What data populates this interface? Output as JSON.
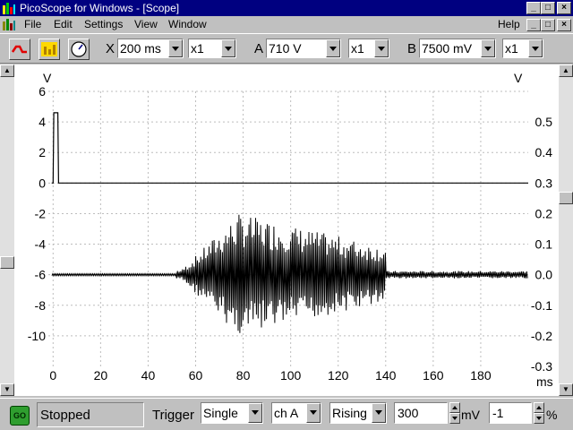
{
  "window": {
    "title": "PicoScope for Windows - [Scope]"
  },
  "menu": {
    "items": [
      "File",
      "Edit",
      "Settings",
      "View",
      "Window"
    ],
    "help": "Help"
  },
  "toolbar": {
    "buttons": [
      {
        "icon": "scope-view-icon"
      },
      {
        "icon": "spectrum-view-icon"
      },
      {
        "icon": "meter-view-icon"
      }
    ],
    "x_label": "X",
    "x_timebase": "200 ms",
    "x_zoom": "x1",
    "a_label": "A",
    "a_range": "710 V",
    "a_zoom": "x1",
    "b_label": "B",
    "b_range": "7500 mV",
    "b_zoom": "x1"
  },
  "chart_data": {
    "type": "line",
    "x_ticks": [
      "0",
      "20",
      "40",
      "60",
      "80",
      "100",
      "120",
      "140",
      "160",
      "180"
    ],
    "x_unit": "ms",
    "xlim": [
      -2,
      200
    ],
    "left_axis": {
      "unit": "V",
      "ticks": [
        "6",
        "4",
        "2",
        "0",
        "-2",
        "-4",
        "-6",
        "-8",
        "-10"
      ],
      "ylim": [
        -12,
        6
      ]
    },
    "right_axis": {
      "unit": "V",
      "ticks": [
        "0.5",
        "0.4",
        "0.3",
        "0.2",
        "0.1",
        "0.0",
        "-0.1",
        "-0.2",
        "-0.3"
      ],
      "ylim": [
        -0.3,
        0.6
      ]
    },
    "grid": true,
    "series": [
      {
        "channel": "A",
        "axis": "left",
        "color": "#000000",
        "points": [
          [
            -0.6,
            0
          ],
          [
            0,
            0
          ],
          [
            0.3,
            4.6
          ],
          [
            2,
            4.6
          ],
          [
            2.3,
            0
          ],
          [
            3,
            0
          ],
          [
            200,
            0
          ]
        ]
      },
      {
        "channel": "B",
        "axis": "right",
        "color": "#000000",
        "baseline": 0.0,
        "burst": {
          "start_ms": 52,
          "end_ms": 140,
          "peak_ms": 78,
          "max_amplitude": 0.2,
          "tail_ms": [
            140,
            200
          ],
          "tail_amplitude": 0.012
        }
      }
    ]
  },
  "status": {
    "go_label": "GO",
    "state": "Stopped",
    "trigger_label": "Trigger",
    "trigger_mode": "Single",
    "trigger_channel": "ch A",
    "trigger_edge": "Rising",
    "threshold": "300",
    "threshold_unit": "mV",
    "delay": "-1",
    "delay_unit": "%"
  }
}
